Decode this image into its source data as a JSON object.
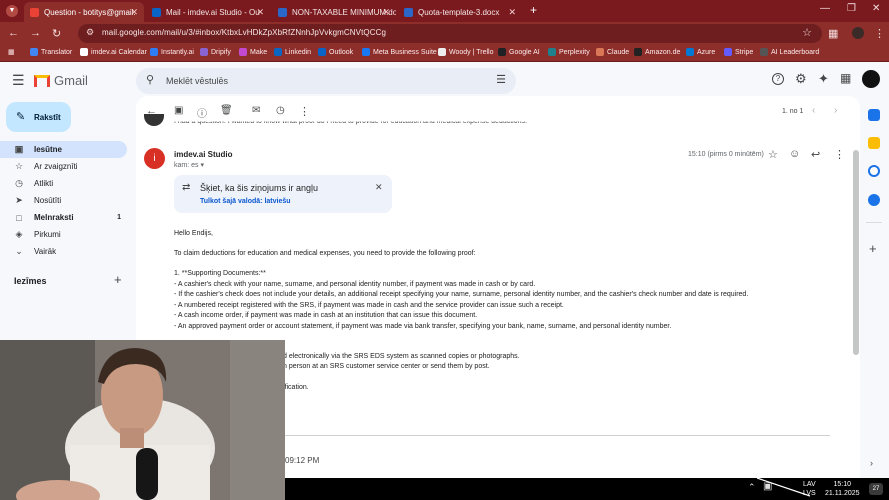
{
  "browser": {
    "tabs": [
      {
        "title": "Question - botitys@gmail.com",
        "active": true
      },
      {
        "title": "Mail - imdev.ai Studio - Outlook",
        "active": false
      },
      {
        "title": "NON-TAXABLE MINIMUM.docx",
        "active": false
      },
      {
        "title": "Quota-template-3.docx",
        "active": false
      }
    ],
    "new_tab": "+",
    "url": "mail.google.com/mail/u/3/#inbox/KtbxLvHDkZpXbRfZNnhJpVvkgmCNVtQCCg",
    "bookmarks": [
      "Translator",
      "imdev.ai Calendar",
      "Instantly.ai",
      "Dripify",
      "Make",
      "Linkedin",
      "Outlook",
      "Meta Business Suite",
      "Woody | Trello",
      "Google AI",
      "Perplexity",
      "Claude",
      "Amazon.de",
      "Azure",
      "Stripe",
      "AI Leaderboard"
    ]
  },
  "gmail": {
    "logo": "Gmail",
    "search_placeholder": "Meklēt vēstulēs",
    "compose_label": "Rakstīt",
    "nav": [
      {
        "label": "Iesūtne",
        "icon": "inbox-icon",
        "active": true,
        "count": ""
      },
      {
        "label": "Ar zvaigznīti",
        "icon": "star-icon",
        "active": false,
        "count": ""
      },
      {
        "label": "Atlikti",
        "icon": "clock-icon",
        "active": false,
        "count": ""
      },
      {
        "label": "Nosūtīti",
        "icon": "send-icon",
        "active": false,
        "count": ""
      },
      {
        "label": "Melnraksti",
        "icon": "draft-icon",
        "active": false,
        "count": "1"
      },
      {
        "label": "Pirkumi",
        "icon": "tag-icon",
        "active": false,
        "count": ""
      },
      {
        "label": "Vairāk",
        "icon": "chevron-down-icon",
        "active": false,
        "count": ""
      }
    ],
    "labels_heading": "Iezīmes",
    "pagination": "1. no 1"
  },
  "message": {
    "prev_snippet": "I had a question. I wanted to know what proof do I need to provide for education and medical expense deductions.",
    "sender": "imdev.ai Studio",
    "avatar_letter": "i",
    "recipient": "kam: es",
    "time": "15:10 (pirms 0 minūtēm)",
    "translate_banner": {
      "title": "Šķiet, ka šis ziņojums ir angļu",
      "link": "Tulkot šajā valodā: latviešu"
    },
    "greeting": "Hello Endijs,",
    "intro": "To claim deductions for education and medical expenses, you need to provide the following proof:",
    "section": "1. **Supporting Documents:**",
    "bullets": [
      "- A cashier's check with your name, surname, and personal identity number, if payment was made in cash or by card.",
      "- If the cashier's check does not include your details, an additional receipt specifying your name, surname, personal identity number, and the cashier's check number and date is required.",
      "- A numbered receipt registered with the SRS, if payment was made in cash and the service provider can issue such a receipt.",
      "- A cash income order, if payment was made in cash at an institution that can issue this document.",
      "- An approved payment order or account statement, if payment was made via bank transfer, specifying your bank, name, surname, and personal identity number."
    ],
    "partial_lines": [
      "d electronically via the SRS EDS system as scanned copies or photographs.",
      "n person at an SRS customer service center or send them by post.",
      "ification."
    ],
    "footer_time": "09:12 PM"
  },
  "taskbar": {
    "lang_top": "LAV",
    "lang_bottom": "LVS",
    "clock_time": "15:10",
    "clock_date": "21.11.2025",
    "notif_count": "27"
  },
  "colors": {
    "browser_frame": "#8e2e2b",
    "gmail_bg": "#f6f8fc",
    "compose_bg": "#c2e7ff",
    "active_nav": "#d3e3fd",
    "avatar_red": "#d93025",
    "link_blue": "#0b57d0"
  }
}
